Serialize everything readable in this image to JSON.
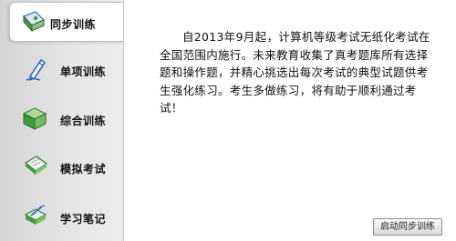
{
  "sidebar": {
    "items": [
      {
        "label": "同步训练",
        "icon": "sync-practice-icon",
        "active": true
      },
      {
        "label": "单项训练",
        "icon": "pen-icon",
        "active": false
      },
      {
        "label": "综合训练",
        "icon": "cube-icon",
        "active": false
      },
      {
        "label": "模拟考试",
        "icon": "exam-paper-icon",
        "active": false
      },
      {
        "label": "学习笔记",
        "icon": "notebook-pen-icon",
        "active": false
      }
    ]
  },
  "main": {
    "description": "自2013年9月起，计算机等级考试无纸化考试在全国范围内施行。未来教育收集了真考题库所有选择题和操作题，并精心挑选出每次考试的典型试题供考生强化练习。考生多做练习，将有助于顺利通过考试！",
    "start_button": "启动同步训练"
  },
  "colors": {
    "sidebar_bg": "#e0e0e0",
    "active_bg": "#ffffff",
    "icon_green": "#3e9a3e",
    "icon_blue": "#3a7cc4"
  }
}
